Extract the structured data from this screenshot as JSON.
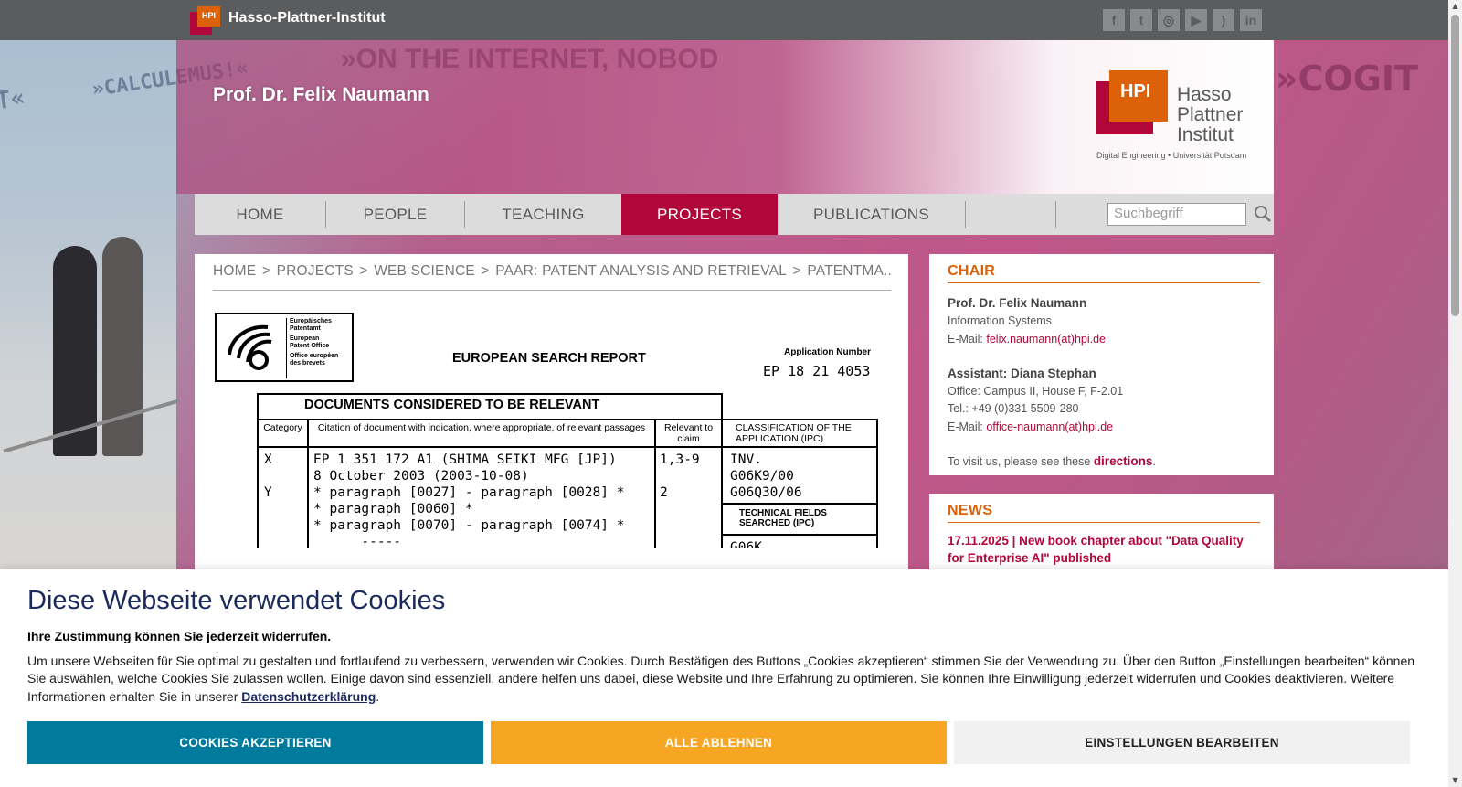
{
  "topbar": {
    "logo_mark": "HPI",
    "brand": "Hasso-Plattner-Institut",
    "social": [
      {
        "icon": "facebook-icon",
        "glyph": "f"
      },
      {
        "icon": "twitter-icon",
        "glyph": "t"
      },
      {
        "icon": "instagram-icon",
        "glyph": "◎"
      },
      {
        "icon": "youtube-icon",
        "glyph": "▶"
      },
      {
        "icon": "rss-icon",
        "glyph": ")"
      },
      {
        "icon": "linkedin-icon",
        "glyph": "in"
      }
    ]
  },
  "background": {
    "left_quotes": [
      "»CALCULEMUS!«",
      "T«"
    ],
    "header_quote": "»ON THE INTERNET, NOBOD",
    "right_quote": "»COGIT"
  },
  "header": {
    "title": "Prof. Dr. Felix Naumann",
    "logo": {
      "mark": "HPI",
      "name_line1": "Hasso",
      "name_line2": "Plattner",
      "name_line3": "Institut",
      "tagline": "Digital Engineering • Universität Potsdam"
    }
  },
  "nav": {
    "items": [
      "HOME",
      "PEOPLE",
      "TEACHING",
      "PROJECTS",
      "PUBLICATIONS",
      ""
    ],
    "active": "PROJECTS",
    "search_placeholder": "Suchbegriff"
  },
  "breadcrumb": [
    "HOME",
    ">",
    "PROJECTS",
    ">",
    "WEB SCIENCE",
    ">",
    "PAAR: PATENT ANALYSIS AND RETRIEVAL",
    ">",
    "PATENTMA..."
  ],
  "document": {
    "office_names": [
      "Europäisches",
      "Patentamt",
      "European",
      "Patent Office",
      "Office européen",
      "des brevets"
    ],
    "title": "EUROPEAN SEARCH REPORT",
    "application_number_label": "Application Number",
    "application_number": "EP 18 21 4053",
    "table_title": "DOCUMENTS CONSIDERED TO BE RELEVANT",
    "col_category": "Category",
    "col_citation": "Citation of document with indication, where appropriate, of relevant passages",
    "col_relevant": "Relevant to claim",
    "col_classification": "CLASSIFICATION OF THE APPLICATION (IPC)",
    "categories": "X\n\nY",
    "citations": "EP 1 351 172 A1 (SHIMA SEIKI MFG [JP])\n8 October 2003 (2003-10-08)\n* paragraph [0027] - paragraph [0028] *\n* paragraph [0060] *\n* paragraph [0070] - paragraph [0074] *\n      -----",
    "relevant": "1,3-9\n\n2",
    "classification": "INV.\nG06K9/00\nG06Q30/06",
    "tech_fields_label": "TECHNICAL FIELDS SEARCHED (IPC)",
    "tech_fields": "G06K"
  },
  "chair": {
    "heading": "CHAIR",
    "name": "Prof. Dr. Felix Naumann",
    "group": "Information Systems",
    "email_label": "E-Mail: ",
    "email": "felix.naumann(at)hpi.de",
    "assistant": "Assistant: Diana Stephan",
    "office": "Office: Campus II, House F, F-2.01",
    "tel": "Tel.: +49 (0)331 5509-280",
    "assistant_email_label": "E-Mail: ",
    "assistant_email": "office-naumann(at)hpi.de",
    "visit_prefix": "To visit us, please see these ",
    "visit_link": "directions",
    "visit_suffix": "."
  },
  "news": {
    "heading": "NEWS",
    "item": "17.11.2025 | New book chapter about \"Data Quality for Enterprise AI\" published"
  },
  "cookie": {
    "title": "Diese Webseite verwendet Cookies",
    "subtitle": "Ihre Zustimmung können Sie jederzeit widerrufen.",
    "text": "Um unsere Webseiten für Sie optimal zu gestalten und fortlaufend zu verbessern, verwenden wir Cookies. Durch Bestätigen des Buttons „Cookies akzeptieren“ stimmen Sie der Verwendung zu. Über den Button „Einstellungen bearbeiten“ können Sie auswählen, welche Cookies Sie zulassen wollen. Einige davon sind essenziell, andere helfen uns dabei, diese Website und Ihre Erfahrung zu optimieren. Sie können Ihre Einwilligung jederzeit widerrufen und Cookies deaktivieren. Weitere Informationen erhalten Sie in unserer ",
    "privacy_link": "Datenschutzerklärung",
    "text_end": ".",
    "accept": "COOKIES AKZEPTIEREN",
    "reject": "ALLE ABLEHNEN",
    "settings": "EINSTELLUNGEN BEARBEITEN"
  },
  "colors": {
    "hpi_red": "#b1063a",
    "hpi_orange": "#dd6108",
    "accept_blue": "#007b9e",
    "reject_orange": "#f6a623",
    "topbar_gray": "#5b5c5e"
  }
}
